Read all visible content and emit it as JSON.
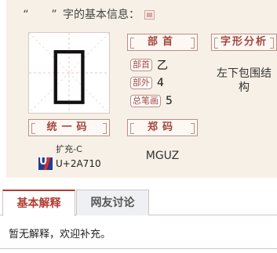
{
  "heading": {
    "open_quote": "“",
    "close_quote": "”",
    "suffix": "字的基本信息：",
    "collapse_icon": "collapse-box-icon"
  },
  "glyph": {
    "char": "𪜐"
  },
  "labels": {
    "radical": "部首",
    "structure": "字形分析",
    "unicode_label": "统一码",
    "zhengma_label": "郑码"
  },
  "attributes": {
    "radical_tag": "部首",
    "radical_value": "乙",
    "strokes_outside_tag": "部外",
    "strokes_outside_value": "4",
    "total_strokes_tag": "总笔画",
    "total_strokes_value": "5"
  },
  "structure": {
    "value": "左下包围结构"
  },
  "unicode": {
    "ext": "扩充-C",
    "code": "U+2A710",
    "logo_icon": "unicode-logo-icon"
  },
  "zhengma": {
    "code": "MGUZ"
  },
  "tabs": [
    {
      "label": "基本解释",
      "active": true
    },
    {
      "label": "网友讨论",
      "active": false
    }
  ],
  "explanation": {
    "text": "暂无解释，欢迎补充。"
  },
  "colors": {
    "accent": "#b23c33",
    "panel_bg": "#f6f0e6",
    "label_border": "#bb8f88"
  }
}
